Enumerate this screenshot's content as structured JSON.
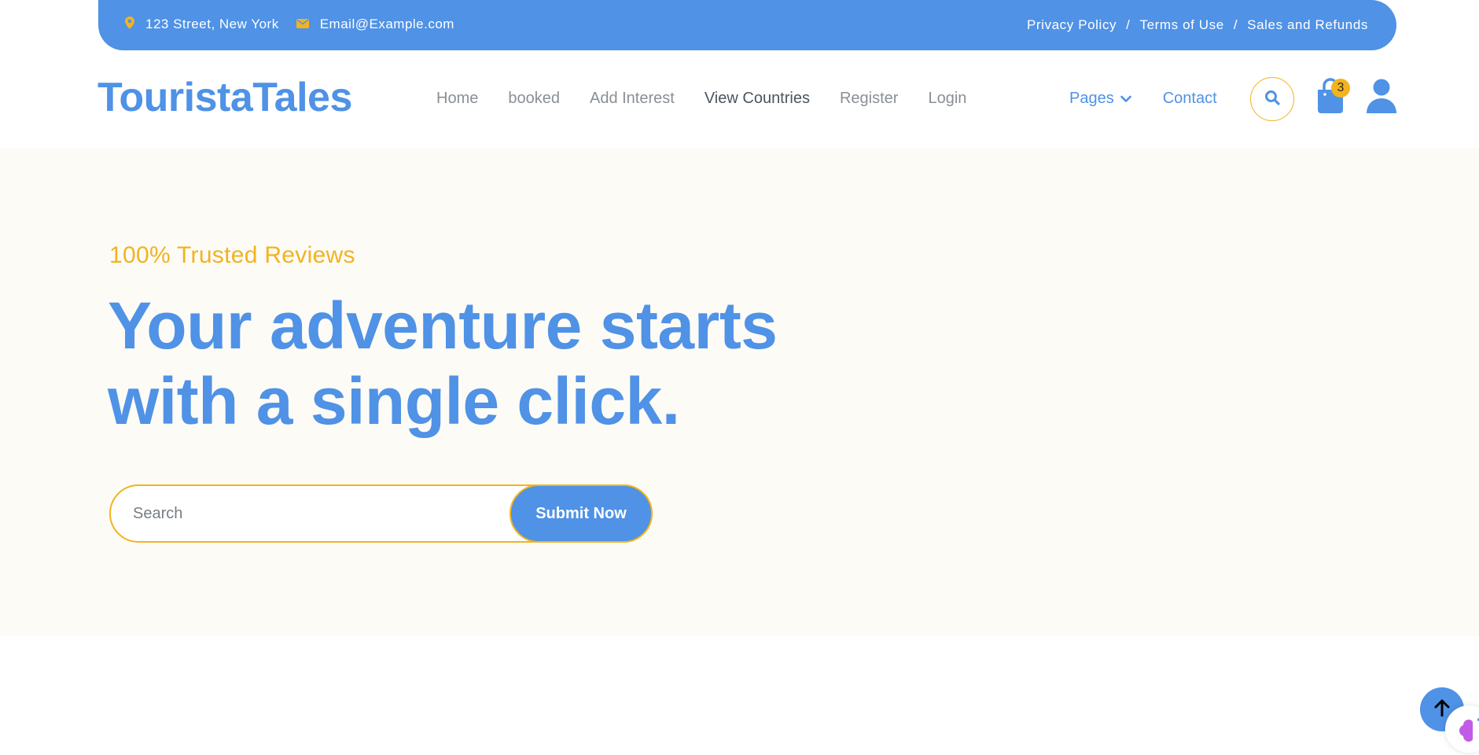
{
  "topbar": {
    "address": "123 Street, New York",
    "email": "Email@Example.com",
    "links": [
      "Privacy Policy",
      "Terms of Use",
      "Sales and Refunds"
    ],
    "separator": "/"
  },
  "navbar": {
    "logo": "TouristaTales",
    "items": [
      "Home",
      "booked",
      "Add Interest",
      "View Countries",
      "Register",
      "Login"
    ],
    "active_item": "View Countries",
    "pages_label": "Pages",
    "contact_label": "Contact",
    "cart_count": "3"
  },
  "hero": {
    "eyebrow": "100% Trusted Reviews",
    "headline_line1": "Your adventure starts",
    "headline_line2": "with a single click.",
    "search_placeholder": "Search",
    "submit_label": "Submit Now"
  },
  "colors": {
    "primary": "#4f92e6",
    "accent": "#f3b31e",
    "hero_bg": "#fcfbf6"
  },
  "icons": [
    "map-pin-icon",
    "envelope-icon",
    "chevron-down-icon",
    "search-icon",
    "shopping-bag-icon",
    "user-icon",
    "arrow-up-icon",
    "brain-icon"
  ]
}
